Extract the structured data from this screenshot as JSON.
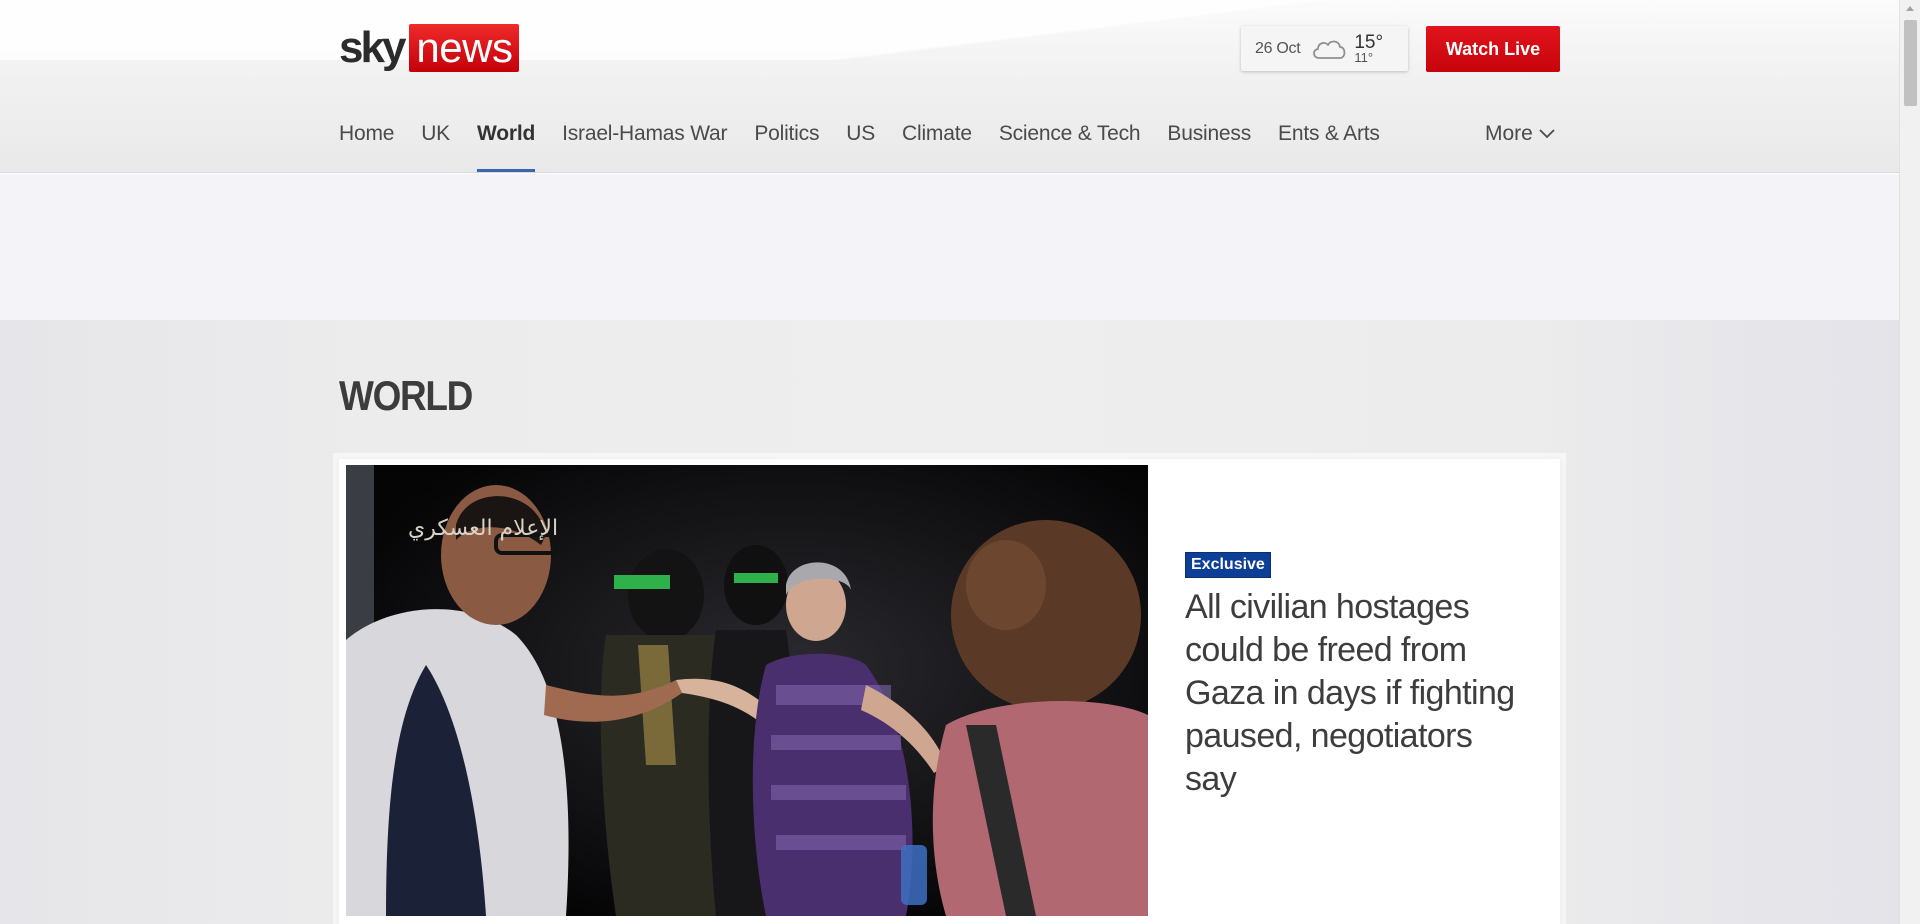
{
  "header": {
    "logo": {
      "part1": "sky",
      "part2": "news"
    },
    "weather": {
      "date": "26 Oct",
      "icon": "cloud-icon",
      "high": "15°",
      "low": "11°"
    },
    "watch_live_label": "Watch Live"
  },
  "nav": {
    "items": [
      {
        "label": "Home"
      },
      {
        "label": "UK"
      },
      {
        "label": "World",
        "active": true
      },
      {
        "label": "Israel-Hamas War"
      },
      {
        "label": "Politics"
      },
      {
        "label": "US"
      },
      {
        "label": "Climate"
      },
      {
        "label": "Science & Tech"
      },
      {
        "label": "Business"
      },
      {
        "label": "Ents & Arts"
      }
    ],
    "more_label": "More"
  },
  "main": {
    "section_title": "WORLD",
    "hero": {
      "badge": "Exclusive",
      "headline": "All civilian hostages could be freed from Gaza in days if fighting paused, negotiators say",
      "image_caption_overlay": "الإعلام العسكري"
    }
  },
  "colors": {
    "brand_red": "#d10a11",
    "active_underline": "#3867b2",
    "badge_blue": "#0e3f96"
  }
}
